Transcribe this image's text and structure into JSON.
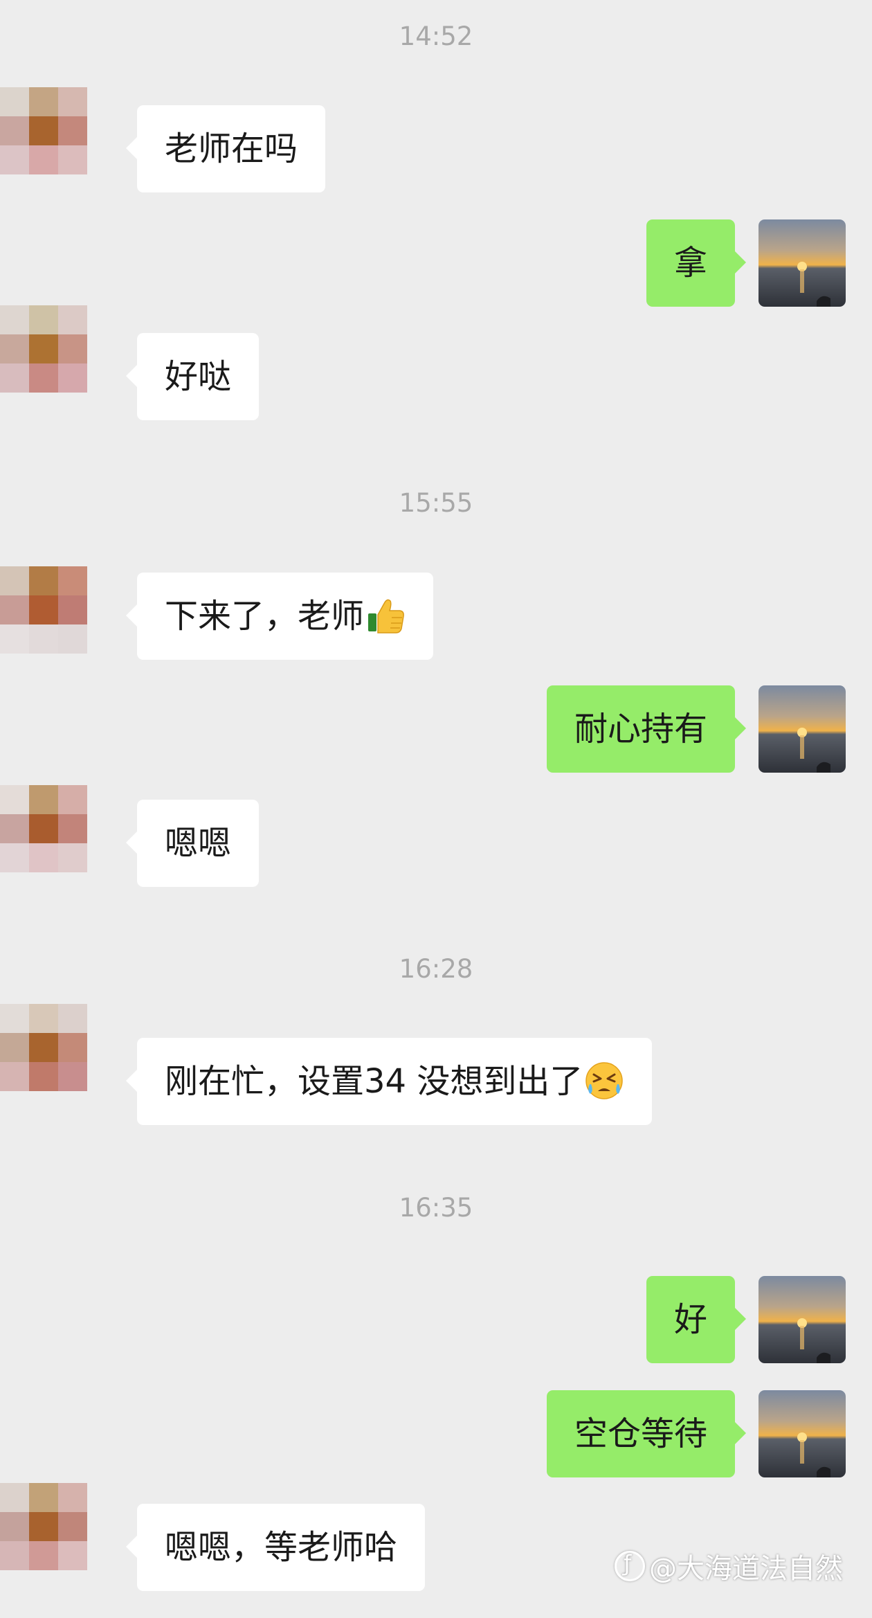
{
  "timestamps": [
    "14:52",
    "15:55",
    "16:28",
    "16:35"
  ],
  "messages": {
    "m1": "老师在吗",
    "m2": "拿",
    "m3": "好哒",
    "m4": "下来了，老师",
    "m5": "耐心持有",
    "m6": "嗯嗯",
    "m7": "刚在忙，设置34 没想到出了",
    "m8": "好",
    "m9": "空仓等待",
    "m10": "嗯嗯，等老师哈"
  },
  "icons": {
    "thumbs_up": "thumbs-up-emoji",
    "sad": "crying-laughing-emoji",
    "self_avatar": "sunset-sea-avatar",
    "contact_avatar": "pixelated-avatar"
  },
  "colors": {
    "background": "#ededed",
    "incoming_bubble": "#ffffff",
    "outgoing_bubble": "#95ec69",
    "timestamp": "#a8a8a8"
  },
  "watermark": {
    "text": "@大海道法自然"
  }
}
